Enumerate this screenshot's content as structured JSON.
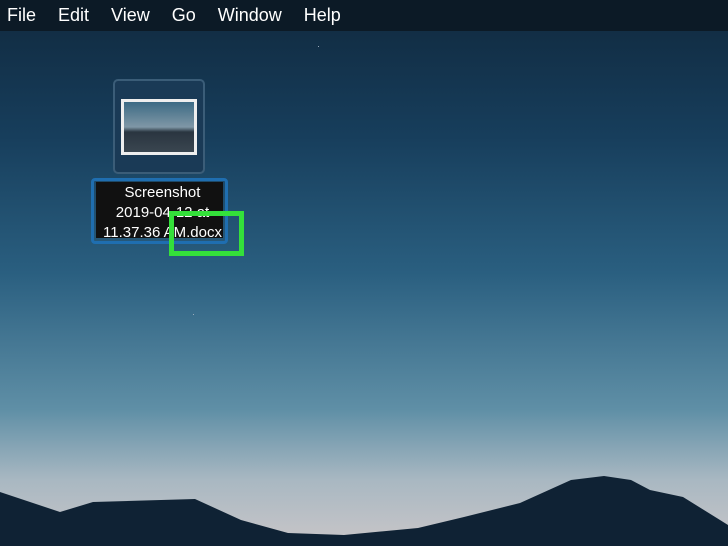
{
  "menubar": {
    "items": [
      "File",
      "Edit",
      "View",
      "Go",
      "Window",
      "Help"
    ]
  },
  "desktop": {
    "file": {
      "name_lines": [
        "Screenshot",
        "2019-04-12 at",
        "11.37.36 AM.docx"
      ],
      "selected": true
    },
    "highlight_color": "#34e03a"
  }
}
